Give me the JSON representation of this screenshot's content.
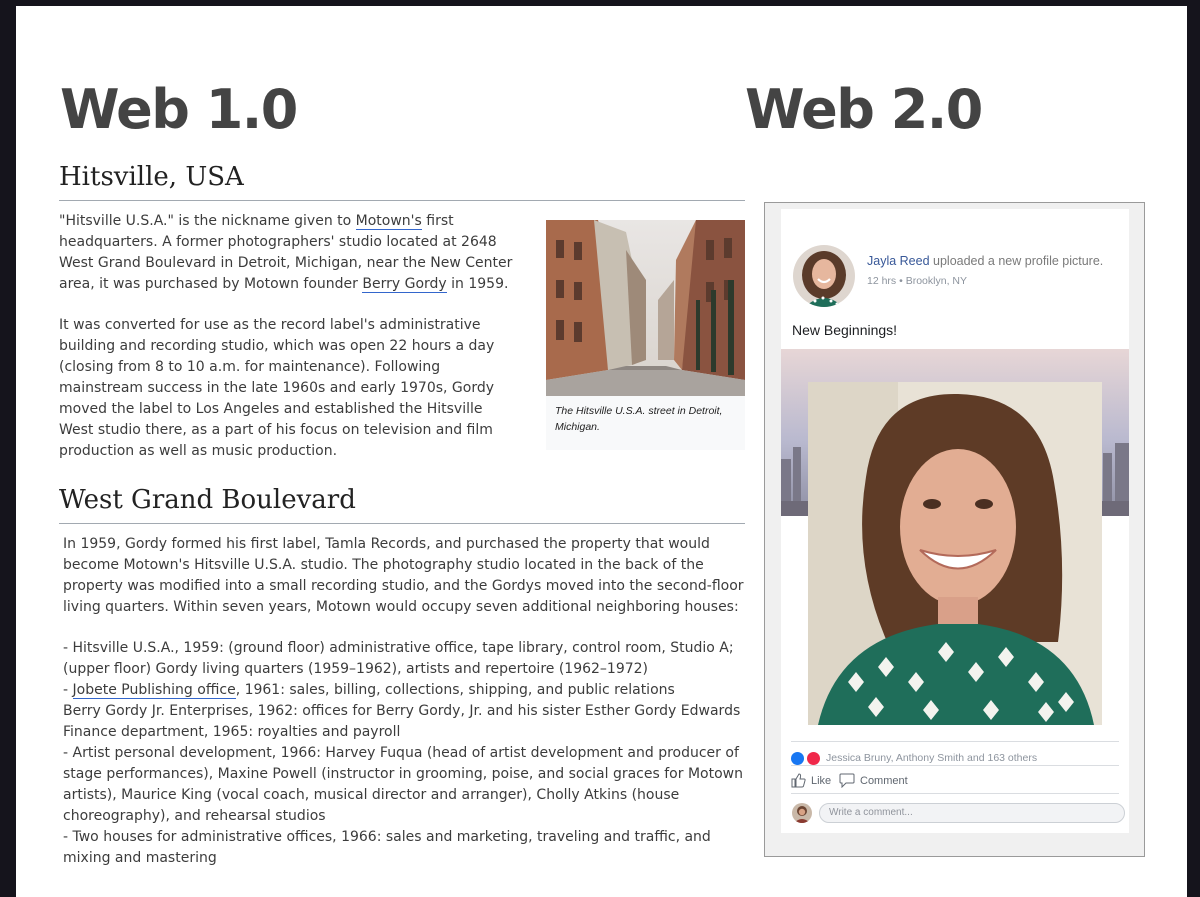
{
  "headings": {
    "left": "Web 1.0",
    "right": "Web 2.0"
  },
  "wiki": {
    "section1_title": "Hitsville, USA",
    "intro": {
      "q1": "\"Hitsville U.S.A.\" is the nickname given to ",
      "motown_link": "Motown's",
      "q2": " first headquarters. A former photographers' studio located at 2648 West Grand Boulevard in Detroit, Michigan, near the New Center area, it was purchased by Motown founder ",
      "gordy_link": "Berry Gordy",
      "q3": " in 1959."
    },
    "para2": "It was converted for use as the record label's administrative building and recording studio, which was open 22 hours a day (closing from 8 to 10 a.m. for maintenance). Following mainstream success in the late 1960s and early 1970s, Gordy moved the label to Los Angeles and established the Hitsville West studio there, as a part of his focus on television and film production as well as music production.",
    "image_caption": "The Hitsville U.S.A. street in Detroit, Michigan.",
    "section2_title": "West Grand Boulevard",
    "para3": "In 1959, Gordy formed his first label, Tamla Records, and purchased the property that would become Motown's Hitsville U.S.A. studio. The photography studio located in the back of the property was modified into a small recording studio, and the Gordys moved into the second-floor living quarters. Within seven years, Motown would occupy seven additional neighboring houses:",
    "list": {
      "item1": "- Hitsville U.S.A., 1959: (ground floor) administrative office, tape library, control room, Studio A; (upper floor) Gordy living quarters (1959–1962), artists and repertoire (1962–1972)",
      "item2_prefix": "- ",
      "item2_link": "Jobete Publishing office",
      "item2_rest": ", 1961: sales, billing, collections, shipping, and public relations",
      "item3": "Berry Gordy Jr. Enterprises, 1962: offices for Berry Gordy, Jr. and his sister Esther Gordy Edwards",
      "item4": "Finance department, 1965: royalties and payroll",
      "item5": "- Artist personal development, 1966: Harvey Fuqua (head of artist development and producer of stage performances), Maxine Powell (instructor in grooming, poise, and social graces for Motown artists), Maurice King (vocal coach, musical director and arranger), Cholly Atkins (house choreography), and rehearsal studios",
      "item6": "- Two houses for administrative offices, 1966: sales and marketing, traveling and traffic, and mixing and mastering"
    }
  },
  "facebook": {
    "user_name": "Jayla Reed",
    "action_text": " uploaded a new profile picture.",
    "time": "12 hrs",
    "separator": "•",
    "location": "Brooklyn, NY",
    "status": "New Beginnings!",
    "reactions_text": "Jessica Bruny, Anthony Smith and 163 others",
    "like_label": "Like",
    "comment_label": "Comment",
    "comment_placeholder": "Write a comment..."
  },
  "colors": {
    "link_underline": "#3366cc",
    "fb_name": "#385898",
    "like_blue": "#1877f2",
    "love_red": "#f0284a"
  }
}
